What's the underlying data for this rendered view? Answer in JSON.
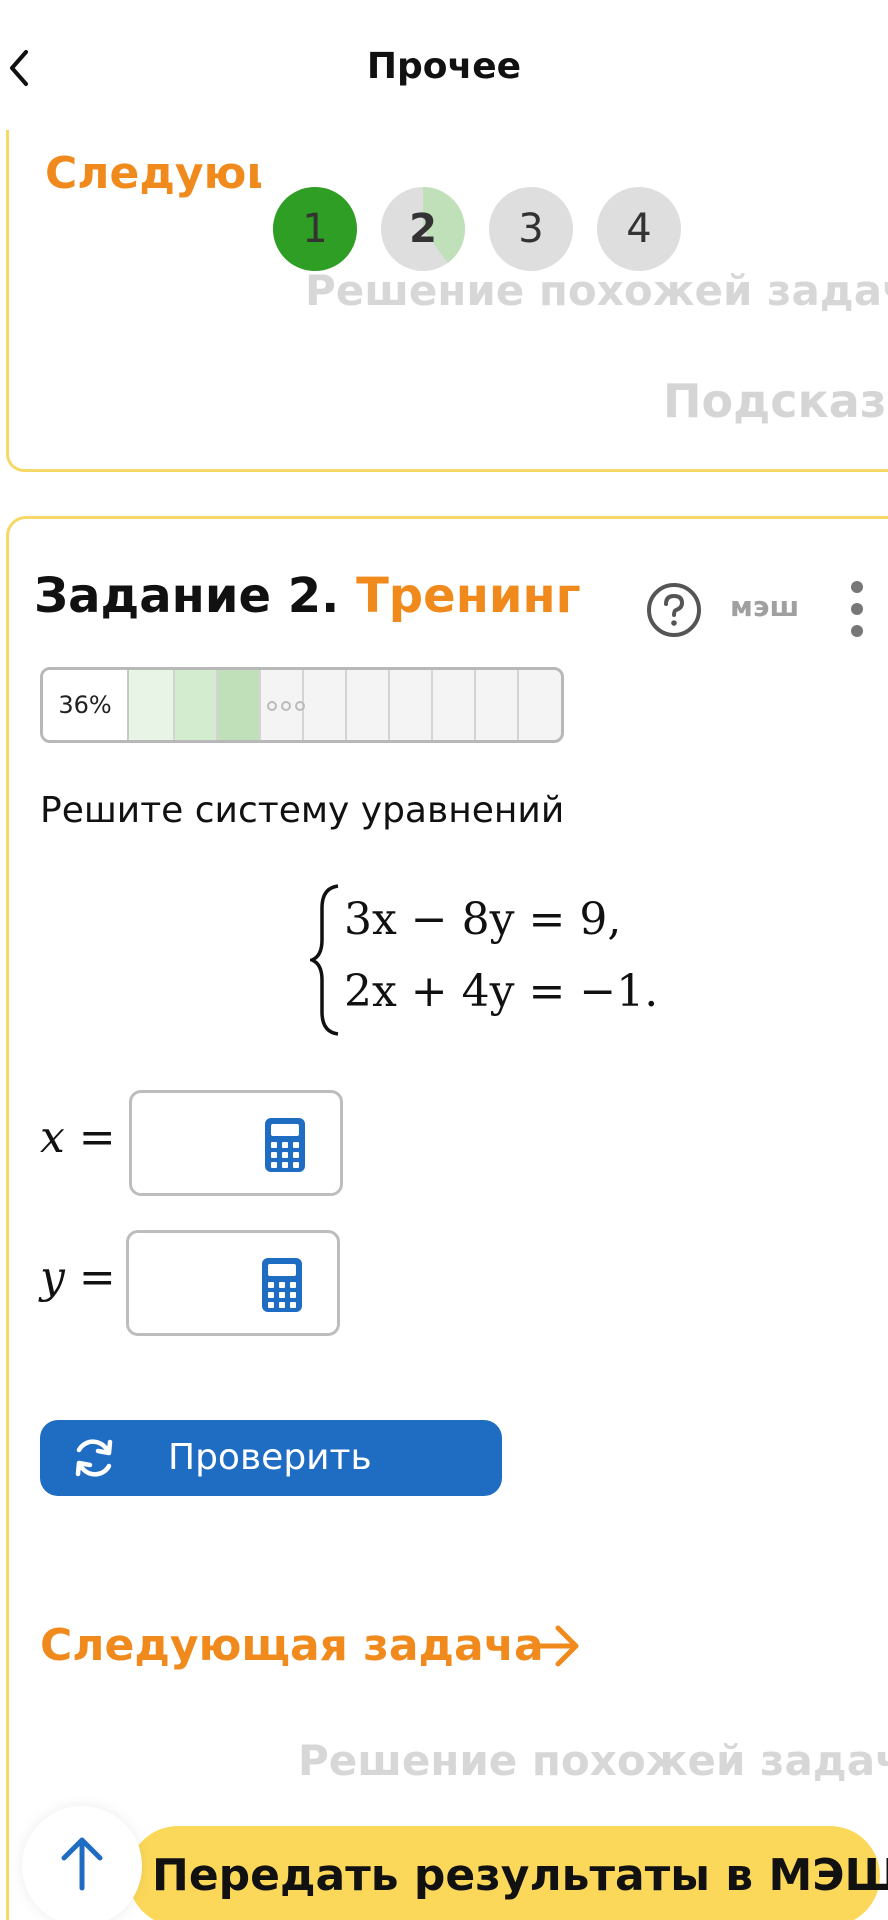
{
  "header": {
    "title": "Прочее",
    "back_icon": "chevron-left-icon"
  },
  "previous_card": {
    "next_task_label": "Следующая задача",
    "similar_label": "Решение похожей задачи",
    "hint_label": "Подсказка"
  },
  "steps": [
    {
      "label": "1",
      "fill": 1.0,
      "color": "#2f9e24"
    },
    {
      "label": "2",
      "fill": 0.4,
      "color": "#bfe0b8"
    },
    {
      "label": "3",
      "fill": 0,
      "color": "#dedede"
    },
    {
      "label": "4",
      "fill": 0,
      "color": "#dedede"
    }
  ],
  "task": {
    "number_label": "Задание 2.",
    "type_label": "Тренинг",
    "mesh_label": "мэш",
    "progress_label": "36%",
    "progress_value": 0.36,
    "problem_text": "Решите систему уравнений",
    "equation_line1": "3x − 8y = 9,",
    "equation_line2": "2x + 4y = −1.",
    "var_x": "x =",
    "var_y": "y ="
  },
  "check_button": {
    "label": "Проверить"
  },
  "next_task": {
    "label": "Следующая задача"
  },
  "similar_task": {
    "label": "Решение похожей задачи"
  },
  "send_button": {
    "label": "Передать результаты в МЭШ"
  },
  "colors": {
    "accent_orange": "#f08a1d",
    "button_blue": "#1f6cc3",
    "card_border": "#f7d866",
    "send_bar": "#fcd85a",
    "progress_green": "#bfe0b8"
  }
}
